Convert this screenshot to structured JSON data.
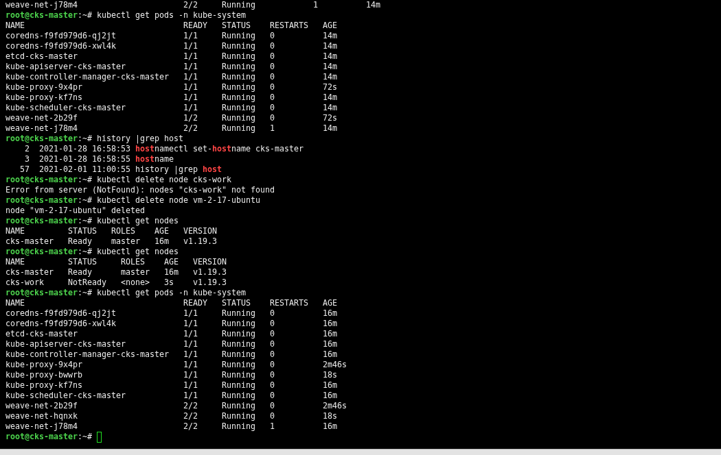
{
  "terminal": {
    "blocks": [
      {
        "kind": "output",
        "text": "weave-net-j78m4                      2/2     Running            1          14m"
      },
      {
        "kind": "prompt",
        "user_host": "root@cks-master",
        "prompt_tail": ":~#",
        "command": "kubectl get pods -n kube-system",
        "cursor": false
      },
      {
        "kind": "table",
        "columns": [
          "NAME",
          "READY",
          "STATUS",
          "RESTARTS",
          "AGE"
        ],
        "rows": [
          [
            "coredns-f9fd979d6-qj2jt",
            "1/1",
            "Running",
            "0",
            "14m"
          ],
          [
            "coredns-f9fd979d6-xwl4k",
            "1/1",
            "Running",
            "0",
            "14m"
          ],
          [
            "etcd-cks-master",
            "1/1",
            "Running",
            "0",
            "14m"
          ],
          [
            "kube-apiserver-cks-master",
            "1/1",
            "Running",
            "0",
            "14m"
          ],
          [
            "kube-controller-manager-cks-master",
            "1/1",
            "Running",
            "0",
            "14m"
          ],
          [
            "kube-proxy-9x4pr",
            "1/1",
            "Running",
            "0",
            "72s"
          ],
          [
            "kube-proxy-kf7ns",
            "1/1",
            "Running",
            "0",
            "14m"
          ],
          [
            "kube-scheduler-cks-master",
            "1/1",
            "Running",
            "0",
            "14m"
          ],
          [
            "weave-net-2b29f",
            "1/2",
            "Running",
            "0",
            "72s"
          ],
          [
            "weave-net-j78m4",
            "2/2",
            "Running",
            "1",
            "14m"
          ]
        ]
      },
      {
        "kind": "prompt",
        "user_host": "root@cks-master",
        "prompt_tail": ":~#",
        "command": "history |grep host",
        "cursor": false
      },
      {
        "kind": "history",
        "number": "2",
        "timestamp": "2021-01-28 16:58:53",
        "segments": [
          {
            "text": "host",
            "match": true
          },
          {
            "text": "namectl set-",
            "match": false
          },
          {
            "text": "host",
            "match": true
          },
          {
            "text": "name cks-master",
            "match": false
          }
        ]
      },
      {
        "kind": "history",
        "number": "3",
        "timestamp": "2021-01-28 16:58:55",
        "segments": [
          {
            "text": "host",
            "match": true
          },
          {
            "text": "name",
            "match": false
          }
        ]
      },
      {
        "kind": "history",
        "number": "57",
        "timestamp": "2021-02-01 11:00:55",
        "segments": [
          {
            "text": "history |grep ",
            "match": false
          },
          {
            "text": "host",
            "match": true
          }
        ]
      },
      {
        "kind": "prompt",
        "user_host": "root@cks-master",
        "prompt_tail": ":~#",
        "command": "kubectl delete node cks-work",
        "cursor": false
      },
      {
        "kind": "output",
        "text": "Error from server (NotFound): nodes \"cks-work\" not found"
      },
      {
        "kind": "prompt",
        "user_host": "root@cks-master",
        "prompt_tail": ":~#",
        "command": "kubectl delete node vm-2-17-ubuntu",
        "cursor": false
      },
      {
        "kind": "output",
        "text": "node \"vm-2-17-ubuntu\" deleted"
      },
      {
        "kind": "prompt",
        "user_host": "root@cks-master",
        "prompt_tail": ":~#",
        "command": "kubectl get nodes",
        "cursor": false
      },
      {
        "kind": "table",
        "columns": [
          "NAME",
          "STATUS",
          "ROLES",
          "AGE",
          "VERSION"
        ],
        "rows": [
          [
            "cks-master",
            "Ready",
            "master",
            "16m",
            "v1.19.3"
          ]
        ]
      },
      {
        "kind": "prompt",
        "user_host": "root@cks-master",
        "prompt_tail": ":~#",
        "command": "kubectl get nodes",
        "cursor": false
      },
      {
        "kind": "table",
        "columns": [
          "NAME",
          "STATUS",
          "ROLES",
          "AGE",
          "VERSION"
        ],
        "rows": [
          [
            "cks-master",
            "Ready",
            "master",
            "16m",
            "v1.19.3"
          ],
          [
            "cks-work",
            "NotReady",
            "<none>",
            "3s",
            "v1.19.3"
          ]
        ]
      },
      {
        "kind": "prompt",
        "user_host": "root@cks-master",
        "prompt_tail": ":~#",
        "command": "kubectl get pods -n kube-system",
        "cursor": false
      },
      {
        "kind": "table",
        "columns": [
          "NAME",
          "READY",
          "STATUS",
          "RESTARTS",
          "AGE"
        ],
        "rows": [
          [
            "coredns-f9fd979d6-qj2jt",
            "1/1",
            "Running",
            "0",
            "16m"
          ],
          [
            "coredns-f9fd979d6-xwl4k",
            "1/1",
            "Running",
            "0",
            "16m"
          ],
          [
            "etcd-cks-master",
            "1/1",
            "Running",
            "0",
            "16m"
          ],
          [
            "kube-apiserver-cks-master",
            "1/1",
            "Running",
            "0",
            "16m"
          ],
          [
            "kube-controller-manager-cks-master",
            "1/1",
            "Running",
            "0",
            "16m"
          ],
          [
            "kube-proxy-9x4pr",
            "1/1",
            "Running",
            "0",
            "2m46s"
          ],
          [
            "kube-proxy-bwwrb",
            "1/1",
            "Running",
            "0",
            "18s"
          ],
          [
            "kube-proxy-kf7ns",
            "1/1",
            "Running",
            "0",
            "16m"
          ],
          [
            "kube-scheduler-cks-master",
            "1/1",
            "Running",
            "0",
            "16m"
          ],
          [
            "weave-net-2b29f",
            "2/2",
            "Running",
            "0",
            "2m46s"
          ],
          [
            "weave-net-hqnxk",
            "2/2",
            "Running",
            "0",
            "18s"
          ],
          [
            "weave-net-j78m4",
            "2/2",
            "Running",
            "1",
            "16m"
          ]
        ]
      },
      {
        "kind": "prompt",
        "user_host": "root@cks-master",
        "prompt_tail": ":~#",
        "cursor": true
      }
    ]
  }
}
